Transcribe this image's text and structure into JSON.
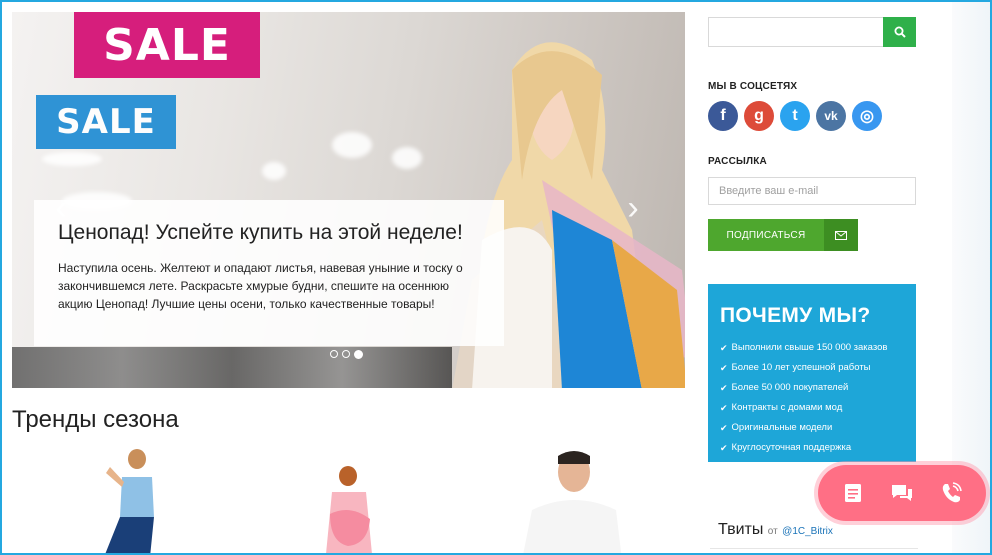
{
  "slider": {
    "sign1": "SALE",
    "sign2": "SALE",
    "arrow_left": "‹",
    "arrow_right": "›",
    "caption_title": "Ценопад! Успейте купить на этой неделе!",
    "caption_text": "Наступила осень. Желтеют и опадают листья, навевая уныние и тоску о закончившемся лете. Раскрасьте хмурые будни, спешите на осеннюю акцию Ценопад! Лучшие цены осени, только качественные товары!",
    "dots": 3,
    "active_dot": 3
  },
  "trends": {
    "title": "Тренды сезона"
  },
  "sidebar": {
    "search_value": "",
    "social_heading": "МЫ В СОЦСЕТЯХ",
    "social": [
      {
        "name": "facebook-icon",
        "glyph": "f",
        "color": "#3b5998"
      },
      {
        "name": "google-plus-icon",
        "glyph": "g",
        "color": "#dd4b39"
      },
      {
        "name": "twitter-icon",
        "glyph": "t",
        "color": "#2aa3ef"
      },
      {
        "name": "vk-icon",
        "glyph": "vk",
        "color": "#4c75a3"
      },
      {
        "name": "instagram-icon",
        "glyph": "◎",
        "color": "#3897f0"
      }
    ],
    "newsletter_heading": "РАССЫЛКА",
    "email_placeholder": "Введите ваш e-mail",
    "subscribe_label": "ПОДПИСАТЬСЯ",
    "why_title": "ПОЧЕМУ МЫ?",
    "why_items": [
      "Выполнили свыше 150 000 заказов",
      "Более 10 лет успешной работы",
      "Более 50 000 покупателей",
      "Контракты с домами мод",
      "Оригинальные модели",
      "Круглосуточная поддержка"
    ],
    "tweets_title": "Твиты",
    "tweets_from": "от",
    "tweets_handle": "@1C_Bitrix"
  },
  "widget": {
    "buttons": [
      "form-icon",
      "chat-icon",
      "phone-icon"
    ]
  },
  "colors": {
    "accent_green": "#2fb04a",
    "subscribe_green": "#4ea72e",
    "why_blue": "#1ea6d8",
    "widget_pink": "#ff6f85",
    "frame_border": "#24a8e0"
  }
}
